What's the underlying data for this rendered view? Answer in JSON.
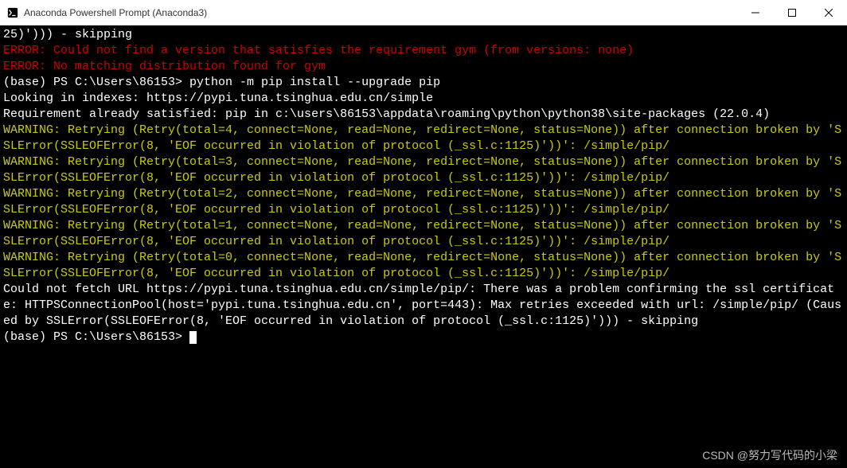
{
  "window": {
    "title": "Anaconda Powershell Prompt (Anaconda3)"
  },
  "prompt": {
    "base": "(base) PS C:\\Users\\86153>",
    "command": "python -m pip install --upgrade pip"
  },
  "terminal": {
    "lines": [
      {
        "cls": "l-norm",
        "text": "25)'))) - skipping"
      },
      {
        "cls": "l-err",
        "text": "ERROR: Could not find a version that satisfies the requirement gym (from versions: none)"
      },
      {
        "cls": "l-err",
        "text": "ERROR: No matching distribution found for gym"
      },
      {
        "cls": "l-norm",
        "text": "(base) PS C:\\Users\\86153> python -m pip install --upgrade pip"
      },
      {
        "cls": "l-norm",
        "text": "Looking in indexes: https://pypi.tuna.tsinghua.edu.cn/simple"
      },
      {
        "cls": "l-norm",
        "text": "Requirement already satisfied: pip in c:\\users\\86153\\appdata\\roaming\\python\\python38\\site-packages (22.0.4)"
      },
      {
        "cls": "l-warn",
        "text": "WARNING: Retrying (Retry(total=4, connect=None, read=None, redirect=None, status=None)) after connection broken by 'SSLError(SSLEOFError(8, 'EOF occurred in violation of protocol (_ssl.c:1125)'))': /simple/pip/"
      },
      {
        "cls": "l-warn",
        "text": "WARNING: Retrying (Retry(total=3, connect=None, read=None, redirect=None, status=None)) after connection broken by 'SSLError(SSLEOFError(8, 'EOF occurred in violation of protocol (_ssl.c:1125)'))': /simple/pip/"
      },
      {
        "cls": "l-warn",
        "text": "WARNING: Retrying (Retry(total=2, connect=None, read=None, redirect=None, status=None)) after connection broken by 'SSLError(SSLEOFError(8, 'EOF occurred in violation of protocol (_ssl.c:1125)'))': /simple/pip/"
      },
      {
        "cls": "l-warn",
        "text": "WARNING: Retrying (Retry(total=1, connect=None, read=None, redirect=None, status=None)) after connection broken by 'SSLError(SSLEOFError(8, 'EOF occurred in violation of protocol (_ssl.c:1125)'))': /simple/pip/"
      },
      {
        "cls": "l-warn",
        "text": "WARNING: Retrying (Retry(total=0, connect=None, read=None, redirect=None, status=None)) after connection broken by 'SSLError(SSLEOFError(8, 'EOF occurred in violation of protocol (_ssl.c:1125)'))': /simple/pip/"
      },
      {
        "cls": "l-norm",
        "text": "Could not fetch URL https://pypi.tuna.tsinghua.edu.cn/simple/pip/: There was a problem confirming the ssl certificate: HTTPSConnectionPool(host='pypi.tuna.tsinghua.edu.cn', port=443): Max retries exceeded with url: /simple/pip/ (Caused by SSLError(SSLEOFError(8, 'EOF occurred in violation of protocol (_ssl.c:1125)'))) - skipping"
      },
      {
        "cls": "l-norm",
        "text": "(base) PS C:\\Users\\86153>"
      }
    ]
  },
  "watermark": "CSDN @努力写代码的小梁"
}
